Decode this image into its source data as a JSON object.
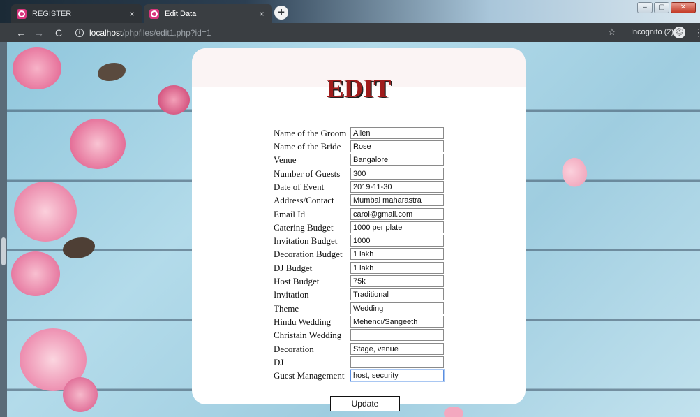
{
  "browser": {
    "tabs": [
      {
        "label": "REGISTER",
        "active": false
      },
      {
        "label": "Edit Data",
        "active": true
      }
    ],
    "new_tab": "+",
    "url_host": "localhost",
    "url_path": "/phpfiles/edit1.php?id=1",
    "incognito": "Incognito (2)",
    "close_glyph": "×",
    "icons": {
      "back": "←",
      "forward": "→",
      "reload": "C",
      "info": "i",
      "star": "☆",
      "menu": "⋮",
      "incognito": "⛑",
      "minimize": "–",
      "maximize": "▢",
      "close_window": "✕"
    }
  },
  "page": {
    "title": "EDIT",
    "fields": [
      {
        "label": "Name of the Groom",
        "value": "Allen"
      },
      {
        "label": "Name of the Bride",
        "value": "Rose"
      },
      {
        "label": "Venue",
        "value": "Bangalore"
      },
      {
        "label": "Number of Guests",
        "value": "300"
      },
      {
        "label": "Date of Event",
        "value": "2019-11-30"
      },
      {
        "label": "Address/Contact",
        "value": "Mumbai maharastra"
      },
      {
        "label": "Email Id",
        "value": "carol@gmail.com"
      },
      {
        "label": "Catering Budget",
        "value": "1000 per plate"
      },
      {
        "label": "Invitation Budget",
        "value": "1000"
      },
      {
        "label": "Decoration Budget",
        "value": "1 lakh"
      },
      {
        "label": "DJ Budget",
        "value": "1 lakh"
      },
      {
        "label": "Host Budget",
        "value": "75k"
      },
      {
        "label": "Invitation",
        "value": "Traditional"
      },
      {
        "label": "Theme",
        "value": "Wedding"
      },
      {
        "label": "Hindu Wedding",
        "value": "Mehendi/Sangeeth"
      },
      {
        "label": "Christain Wedding",
        "value": ""
      },
      {
        "label": "Decoration",
        "value": "Stage, venue"
      },
      {
        "label": "DJ",
        "value": ""
      },
      {
        "label": "Guest Management",
        "value": "host, security"
      }
    ],
    "update_label": "Update"
  },
  "colors": {
    "title": "#a01c1c",
    "card": "#ffffff",
    "background_wood": "#9fcde0",
    "flower": "#e86c98"
  }
}
